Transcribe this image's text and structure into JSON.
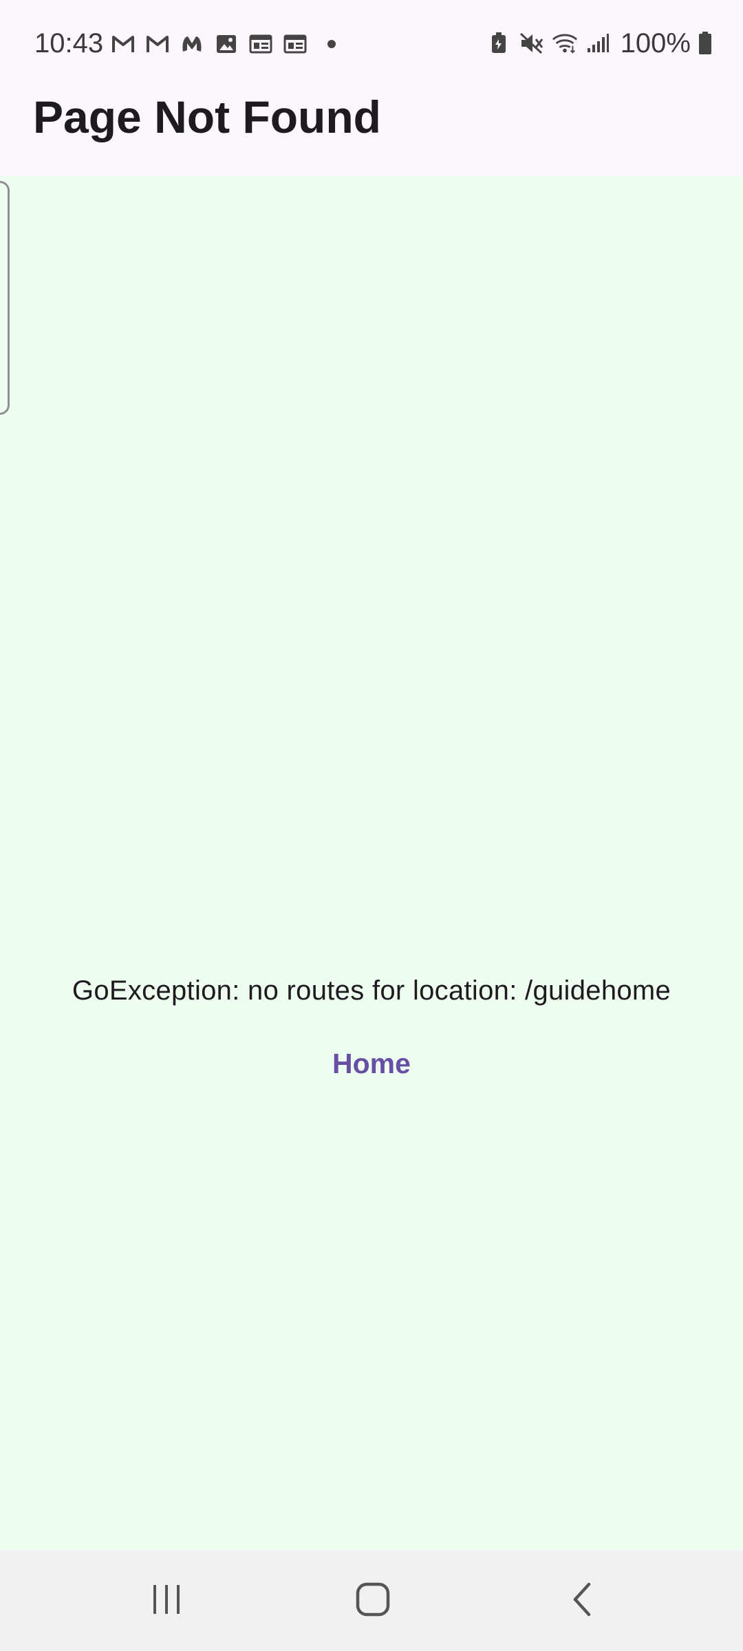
{
  "status_bar": {
    "time": "10:43",
    "battery_percent": "100%",
    "notification_icons": [
      "gmail-icon",
      "gmail-icon",
      "malwarebytes-icon",
      "photos-icon",
      "news-icon",
      "news-icon"
    ],
    "system_icons": [
      "battery-saver-icon",
      "mute-icon",
      "wifi-icon",
      "signal-icon",
      "battery-icon"
    ]
  },
  "app_bar": {
    "title": "Page Not Found"
  },
  "main": {
    "error_message": "GoException: no routes for location: /guidehome",
    "home_button_label": "Home"
  },
  "nav_bar": {
    "buttons": [
      "recent-apps",
      "home",
      "back"
    ]
  },
  "colors": {
    "app_bar_bg": "#fdf6fd",
    "content_bg": "#eefdf0",
    "accent": "#6750a4",
    "nav_bar_bg": "#f1f1f1"
  }
}
